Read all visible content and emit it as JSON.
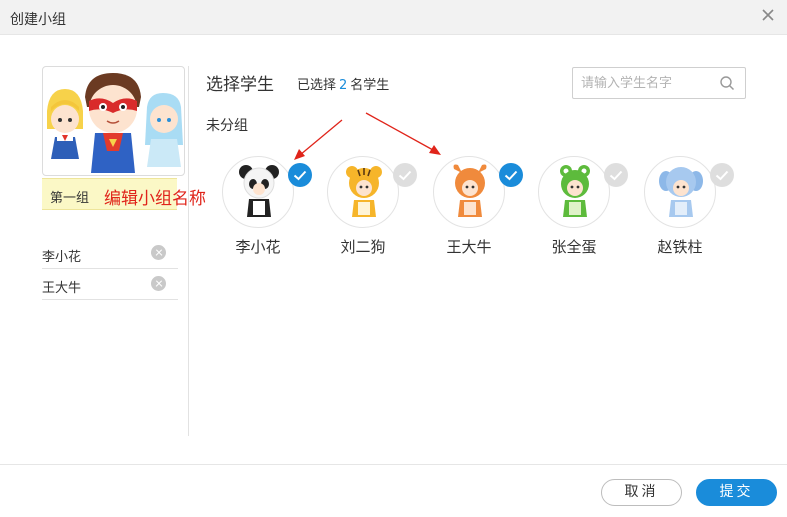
{
  "dialog": {
    "title": "创建小组"
  },
  "group": {
    "name": "第一组",
    "edit_hint": "编辑小组名称",
    "members": [
      {
        "name": "李小花"
      },
      {
        "name": "王大牛"
      }
    ]
  },
  "select_panel": {
    "title": "选择学生",
    "selected_prefix": "已选择",
    "selected_count": "2",
    "selected_suffix": "名学生",
    "search_placeholder": "请输入学生名字",
    "section_label": "未分组"
  },
  "students": [
    {
      "name": "李小花",
      "avatar": "panda",
      "selected": true
    },
    {
      "name": "刘二狗",
      "avatar": "tiger",
      "selected": false
    },
    {
      "name": "王大牛",
      "avatar": "ox",
      "selected": true
    },
    {
      "name": "张全蛋",
      "avatar": "frog",
      "selected": false
    },
    {
      "name": "赵铁柱",
      "avatar": "elephant",
      "selected": false
    }
  ],
  "footer": {
    "cancel_label": "取消",
    "submit_label": "提交"
  },
  "colors": {
    "accent": "#1a8cda",
    "hint_red": "#e0241a",
    "name_bar": "#fbf8c6"
  }
}
